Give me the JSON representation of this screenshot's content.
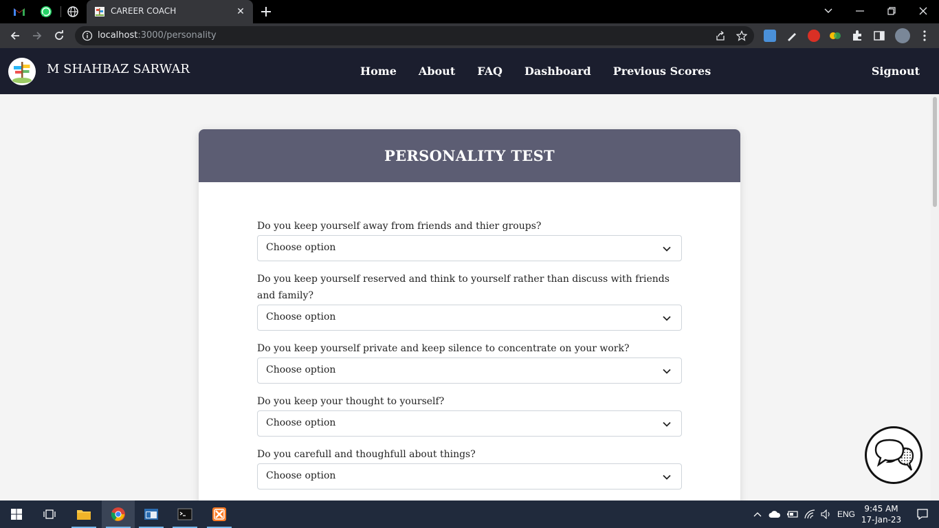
{
  "browser": {
    "tab_title": "CAREER COACH",
    "url_host": "localhost",
    "url_path": ":3000/personality"
  },
  "site": {
    "brand": "M SHAHBAZ SARWAR",
    "nav": [
      "Home",
      "About",
      "FAQ",
      "Dashboard",
      "Previous Scores"
    ],
    "signout": "Signout"
  },
  "test": {
    "title": "PERSONALITY TEST",
    "questions": [
      {
        "label": "Do you keep yourself away from friends and thier groups?",
        "value": "Choose option"
      },
      {
        "label": "Do you keep yourself reserved and think to yourself rather than discuss with friends and family?",
        "value": "Choose option"
      },
      {
        "label": "Do you keep yourself private and keep silence to concentrate on your work?",
        "value": "Choose option"
      },
      {
        "label": "Do you keep your thought to yourself?",
        "value": "Choose option"
      },
      {
        "label": "Do you carefull and thoughfull about things?",
        "value": "Choose option"
      }
    ]
  },
  "taskbar": {
    "lang": "ENG",
    "time": "9:45 AM",
    "date": "17-Jan-23"
  },
  "colors": {
    "navbar": "#1b1e2e",
    "card_header": "#5c5d73",
    "taskbar": "#202a3c"
  }
}
